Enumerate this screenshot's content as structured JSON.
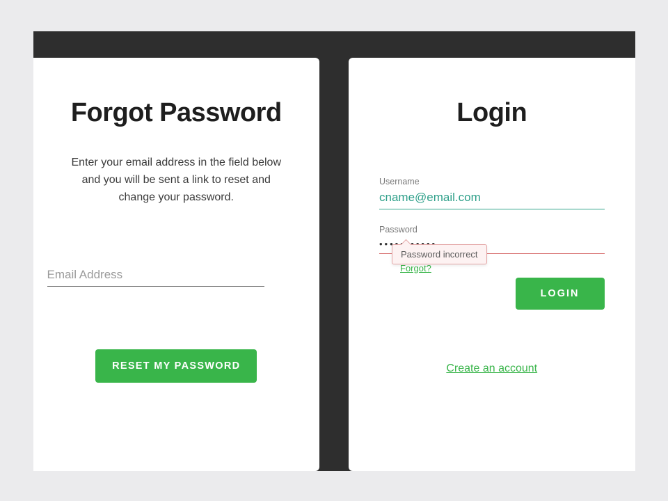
{
  "forgot": {
    "title": "Forgot Password",
    "description": "Enter your email address in the field below and you will be sent a link to reset and change your password.",
    "email_placeholder": "Email Address",
    "email_value": "",
    "submit_label": "RESET MY PASSWORD"
  },
  "login": {
    "title": "Login",
    "username_label": "Username",
    "username_value": "cname@email.com",
    "password_label": "Password",
    "password_value": "•••••••••••",
    "forgot_link": "Forgot?",
    "error_message": "Password incorrect",
    "submit_label": "LOGIN",
    "create_link": "Create an account"
  },
  "colors": {
    "accent": "#39b54a",
    "success": "#2fa08a",
    "error_border": "#d66b6b",
    "error_bg": "#fdf2f2"
  }
}
